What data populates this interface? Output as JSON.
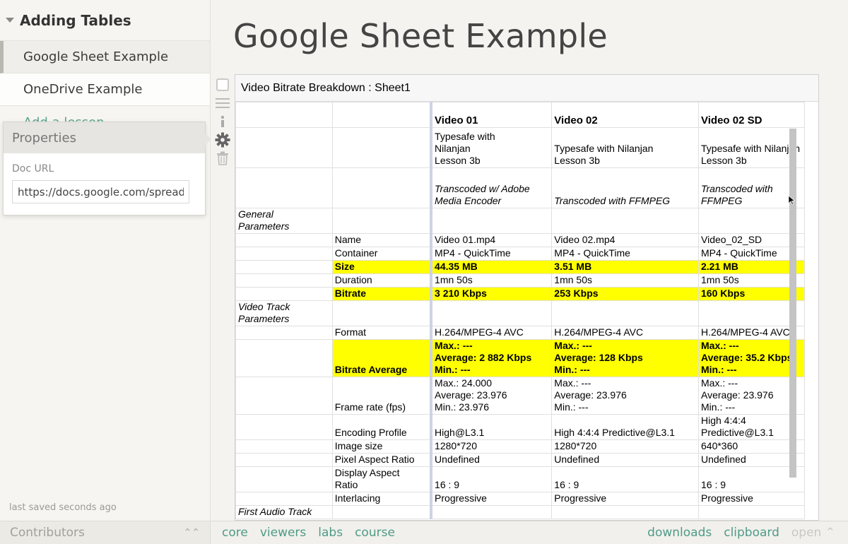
{
  "sidebar": {
    "section_title": "Adding Tables",
    "lessons": [
      {
        "label": "Google Sheet Example"
      },
      {
        "label": "OneDrive Example"
      }
    ],
    "add_lesson": "Add a lesson",
    "last_saved": "last saved seconds ago",
    "contributors": "Contributors"
  },
  "properties": {
    "title": "Properties",
    "doc_url_label": "Doc URL",
    "doc_url_value": "https://docs.google.com/spreadsheets"
  },
  "tools": [
    "checkbox-icon",
    "drag-lines-icon",
    "info-icon",
    "gear-icon",
    "trash-icon"
  ],
  "main": {
    "title": "Google Sheet Example",
    "sheet_title": "Video Bitrate Breakdown : Sheet1",
    "table": {
      "headers": [
        "Video 01",
        "Video 02",
        "Video 02 SD"
      ],
      "subtitles": [
        "Typesafe with\nNilanjan\nLesson 3b",
        "Typesafe with Nilanjan\nLesson 3b",
        "Typesafe with Nilanjan\nLesson 3b"
      ],
      "notes": [
        "Transcoded w/ Adobe\nMedia Encoder",
        "Transcoded with FFMPEG",
        "Transcoded with\nFFMPEG"
      ],
      "general_section": "General\nParameters",
      "general_rows": [
        {
          "label": "Name",
          "values": [
            "Video 01.mp4",
            "Video 02.mp4",
            "Video_02_SD"
          ],
          "highlight": false
        },
        {
          "label": "Container",
          "values": [
            "MP4 - QuickTime",
            "MP4 - QuickTime",
            "MP4 - QuickTime"
          ],
          "highlight": false
        },
        {
          "label": "Size",
          "values": [
            "44.35 MB",
            "3.51 MB",
            "2.21 MB"
          ],
          "highlight": true
        },
        {
          "label": "Duration",
          "values": [
            "1mn 50s",
            "1mn 50s",
            "1mn 50s"
          ],
          "highlight": false
        },
        {
          "label": "Bitrate",
          "values": [
            "3 210 Kbps",
            "253 Kbps",
            "160 Kbps"
          ],
          "highlight": true
        }
      ],
      "video_section": "Video Track\nParameters",
      "video_rows": [
        {
          "label": "Format",
          "values": [
            "H.264/MPEG-4 AVC",
            "H.264/MPEG-4 AVC",
            "H.264/MPEG-4 AVC"
          ],
          "highlight": false
        },
        {
          "label": "Bitrate Average",
          "values": [
            "Max.: ---\nAverage: 2 882 Kbps\nMin.: ---",
            "Max.: ---\nAverage: 128 Kbps\nMin.: ---",
            "Max.: ---\nAverage: 35.2 Kbps\nMin.: ---"
          ],
          "highlight": true
        },
        {
          "label": "Frame rate (fps)",
          "values": [
            "Max.: 24.000\nAverage: 23.976\nMin.: 23.976",
            "Max.: ---\nAverage: 23.976\nMin.: ---",
            "Max.: ---\nAverage: 23.976\nMin.: ---"
          ],
          "highlight": false
        },
        {
          "label": "Encoding Profile",
          "values": [
            "High@L3.1",
            "High 4:4:4 Predictive@L3.1",
            "High 4:4:4\nPredictive@L3.1"
          ],
          "highlight": false
        },
        {
          "label": "Image size",
          "values": [
            "1280*720",
            "1280*720",
            "640*360"
          ],
          "highlight": false
        },
        {
          "label": "Pixel Aspect Ratio",
          "values": [
            "Undefined",
            "Undefined",
            "Undefined"
          ],
          "highlight": false
        },
        {
          "label": "Display Aspect\nRatio",
          "values": [
            "16 : 9",
            "16 : 9",
            "16 : 9"
          ],
          "highlight": false
        },
        {
          "label": "Interlacing",
          "values": [
            "Progressive",
            "Progressive",
            "Progressive"
          ],
          "highlight": false
        }
      ],
      "audio_section": "First Audio Track"
    }
  },
  "bottom_nav": {
    "left": [
      "core",
      "viewers",
      "labs",
      "course"
    ],
    "right": [
      "downloads",
      "clipboard"
    ],
    "open": "open"
  }
}
